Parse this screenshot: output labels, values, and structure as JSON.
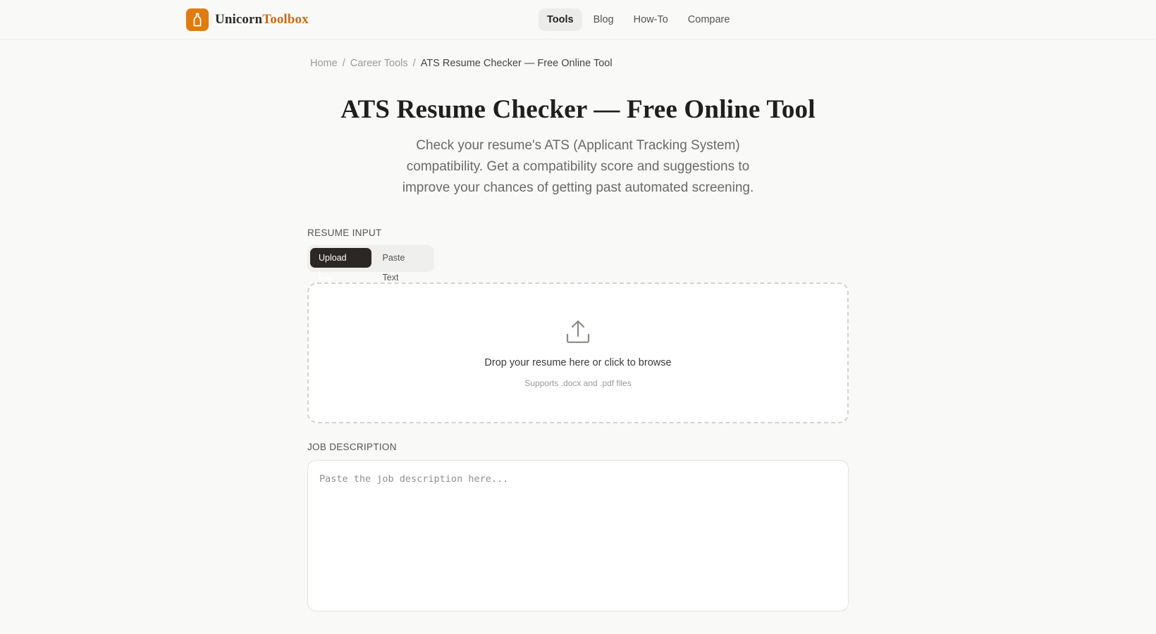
{
  "brand": {
    "name_primary": "Unicorn",
    "name_accent": "Toolbox",
    "accent_color": "#e07b12"
  },
  "nav": {
    "items": [
      {
        "label": "Tools",
        "active": true
      },
      {
        "label": "Blog",
        "active": false
      },
      {
        "label": "How-To",
        "active": false
      },
      {
        "label": "Compare",
        "active": false
      }
    ]
  },
  "breadcrumb": {
    "separator": "/",
    "items": [
      "Home",
      "Career Tools",
      "ATS Resume Checker — Free Online Tool"
    ]
  },
  "page": {
    "title": "ATS Resume Checker — Free Online Tool",
    "subtitle": "Check your resume's ATS (Applicant Tracking System) compatibility. Get a compatibility score and suggestions to improve your chances of getting past automated screening."
  },
  "resume_input": {
    "label": "RESUME INPUT",
    "tabs": [
      {
        "label": "Upload File",
        "active": true
      },
      {
        "label": "Paste Text",
        "active": false
      }
    ],
    "dropzone": {
      "icon": "upload-icon",
      "text": "Drop your resume here or click to browse",
      "subtext": "Supports .docx and .pdf files"
    }
  },
  "job_description": {
    "label": "JOB DESCRIPTION",
    "value": "",
    "placeholder": "Paste the job description here..."
  }
}
